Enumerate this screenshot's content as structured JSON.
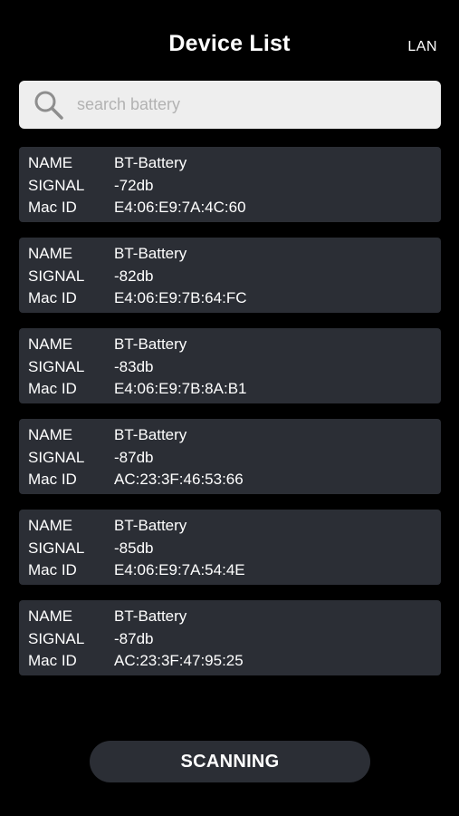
{
  "header": {
    "title": "Device List",
    "lan_label": "LAN"
  },
  "search": {
    "placeholder": "search battery",
    "value": "",
    "icon": "search-icon"
  },
  "row_labels": {
    "name": "NAME",
    "signal": "SIGNAL",
    "mac": "Mac ID"
  },
  "devices": [
    {
      "name": "BT-Battery",
      "signal": "-72db",
      "mac": "E4:06:E9:7A:4C:60"
    },
    {
      "name": "BT-Battery",
      "signal": "-82db",
      "mac": "E4:06:E9:7B:64:FC"
    },
    {
      "name": "BT-Battery",
      "signal": "-83db",
      "mac": "E4:06:E9:7B:8A:B1"
    },
    {
      "name": "BT-Battery",
      "signal": "-87db",
      "mac": "AC:23:3F:46:53:66"
    },
    {
      "name": "BT-Battery",
      "signal": "-85db",
      "mac": "E4:06:E9:7A:54:4E"
    },
    {
      "name": "BT-Battery",
      "signal": "-87db",
      "mac": "AC:23:3F:47:95:25"
    }
  ],
  "scan_button": {
    "label": "SCANNING"
  },
  "colors": {
    "background": "#000000",
    "card": "#2b2e35",
    "search_bg": "#eeeeee",
    "placeholder": "#b2b2b2",
    "text": "#ffffff"
  }
}
